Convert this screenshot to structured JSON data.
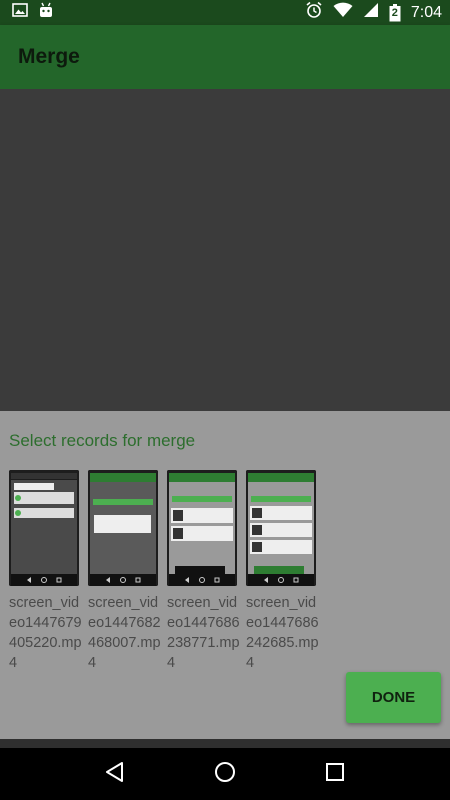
{
  "status_bar": {
    "time": "7:04",
    "battery_level": "2",
    "icons": [
      "image-icon",
      "android-icon",
      "alarm-icon",
      "wifi-icon",
      "signal-icon",
      "battery-icon"
    ],
    "background": "#1b4a1d"
  },
  "app_bar": {
    "title": "Merge",
    "background": "#23662a"
  },
  "sheet": {
    "title": "Select records for merge",
    "items": [
      {
        "label": "screen_video1447679405220.mp4"
      },
      {
        "label": "screen_video1447682468007.mp4"
      },
      {
        "label": "screen_video1447686238771.mp4"
      },
      {
        "label": "screen_video1447686242685.mp4"
      }
    ],
    "done_label": "DONE",
    "accent": "#4caf50"
  },
  "nav_bar": {
    "icons": [
      "back-icon",
      "home-icon",
      "recents-icon"
    ]
  }
}
